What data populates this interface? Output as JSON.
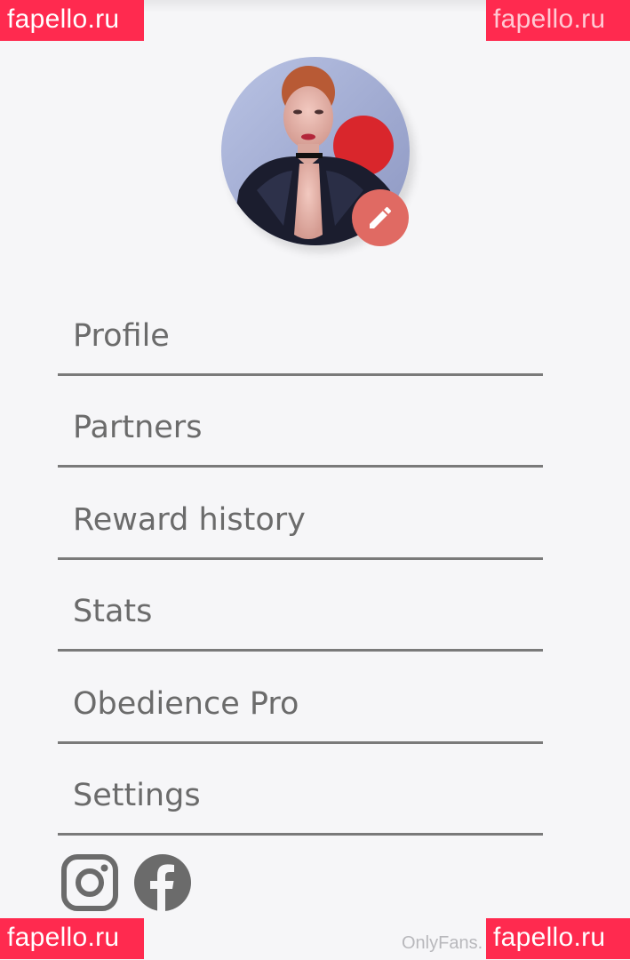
{
  "watermarks": {
    "top_left": "fapello.ru",
    "top_right": "fapello.ru",
    "bottom_left": "fapello.ru",
    "bottom_right": "fapello.ru"
  },
  "profile": {
    "avatar_alt": "Profile photo",
    "edit_icon": "pencil-icon",
    "edit_color": "#e06a63"
  },
  "menu": {
    "items": [
      {
        "label": "Profile"
      },
      {
        "label": "Partners"
      },
      {
        "label": "Reward history"
      },
      {
        "label": "Stats"
      },
      {
        "label": "Obedience Pro"
      },
      {
        "label": "Settings"
      }
    ]
  },
  "socials": {
    "instagram_icon": "instagram-icon",
    "facebook_icon": "facebook-icon"
  },
  "footer": {
    "onlyfans_mark": "OnlyFans."
  },
  "colors": {
    "background": "#f6f6f8",
    "divider": "#7a7a7a",
    "text": "#6b6b6b",
    "watermark": "#ff2a4f"
  }
}
